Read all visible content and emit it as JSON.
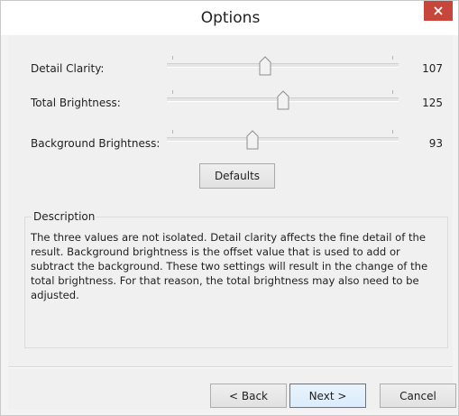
{
  "window": {
    "title": "Options",
    "close_glyph": "✕"
  },
  "settings": [
    {
      "label": "Detail Clarity:",
      "value": "107",
      "level": 0.425
    },
    {
      "label": "Total Brightness:",
      "value": "125",
      "level": 0.5
    },
    {
      "label": "Background Brightness:",
      "value": "93",
      "level": 0.37
    }
  ],
  "defaults_button": "Defaults",
  "description": {
    "legend": "Description",
    "text": "The three values are not isolated. Detail clarity affects the fine detail of the result. Background brightness is the offset value that is used to add or subtract the background. These two settings will result in the change of the total brightness. For that reason, the total brightness may also need to be adjusted."
  },
  "buttons": {
    "back": "< Back",
    "next": "Next >",
    "cancel": "Cancel"
  },
  "colors": {
    "close_red": "#c7463b",
    "accent_border": "#3c7fb1"
  }
}
